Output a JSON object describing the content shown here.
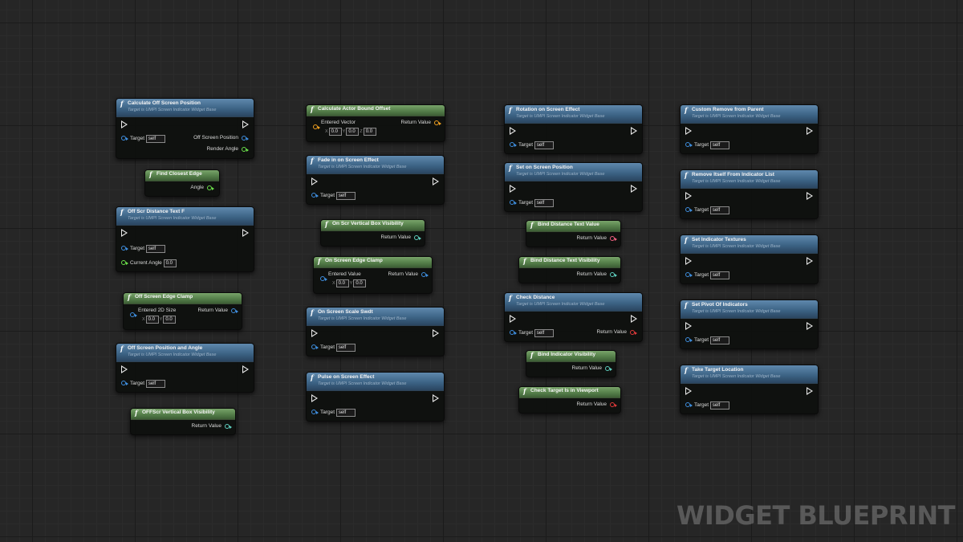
{
  "watermark": "WIDGET BLUEPRINT",
  "common": {
    "subtitle": "Target is UMPI Screen Indicator Widget Base",
    "target": "Target",
    "self": "self",
    "return_value": "Return Value",
    "zero": "0.0",
    "x": "X",
    "y": "Y",
    "z": "Z"
  },
  "nodes": {
    "calc_off_screen_position": {
      "title": "Calculate Off Screen Position",
      "out1": "Off Screen Position",
      "out2": "Render Angle"
    },
    "find_closest_edge": {
      "title": "Find Closest Edge",
      "out": "Angle"
    },
    "off_scr_distance_text": {
      "title": "Off Scr Distance Text F",
      "in2": "Current Angle"
    },
    "off_screen_edge_clamp": {
      "title": "Off Screen Edge Clamp",
      "in": "Entered 2D Size"
    },
    "off_screen_position_angle": {
      "title": "Off Screen Position and Angle"
    },
    "offscr_vertical_box_visibility": {
      "title": "OFFScr Vertical Box Visibility"
    },
    "calc_actor_bound_offset": {
      "title": "Calculate Actor Bound Offset",
      "in": "Entered Vector"
    },
    "fade_in_screen_effect": {
      "title": "Fade in on Screen Effect"
    },
    "on_scr_vertical_box_visibility": {
      "title": "On Scr Vertical Box Visibility"
    },
    "on_screen_edge_clamp": {
      "title": "On Screen Edge Clamp",
      "in": "Entered Value"
    },
    "on_screen_scale_switch": {
      "title": "On Screen Scale Swdt"
    },
    "pulse_on_screen_effect": {
      "title": "Pulse on Screen Effect"
    },
    "rotation_on_screen_effect": {
      "title": "Rotation on Screen Effect"
    },
    "set_on_screen_position": {
      "title": "Set on Screen Position"
    },
    "bind_distance_text_value": {
      "title": "Bind Distance Text Value"
    },
    "bind_distance_text_visibility": {
      "title": "Bind Distance Text Visibility"
    },
    "check_distance": {
      "title": "Check Distance"
    },
    "bind_indicator_visibility": {
      "title": "Bind Indicator Visibility"
    },
    "check_target_in_viewport": {
      "title": "Check Target Is in Viewport"
    },
    "custom_remove_from_parent": {
      "title": "Custom Remove from Parent"
    },
    "remove_itself_from_list": {
      "title": "Remove Itself From Indicator List"
    },
    "set_indicator_textures": {
      "title": "Set Indicator Textures"
    },
    "set_pivot_of_indicators": {
      "title": "Set Pivot Of Indicators"
    },
    "take_target_location": {
      "title": "Take Target Location"
    }
  },
  "colors": {
    "object_pin": "#3f8fe0",
    "float_pin": "#6be04a",
    "vector_pin": "#f0a020",
    "bool_pin": "#e03a3a",
    "text_pin": "#f06080",
    "slate_pin": "#5fd0c0",
    "pure_header": "#557f4a",
    "function_header": "#3d6486"
  }
}
